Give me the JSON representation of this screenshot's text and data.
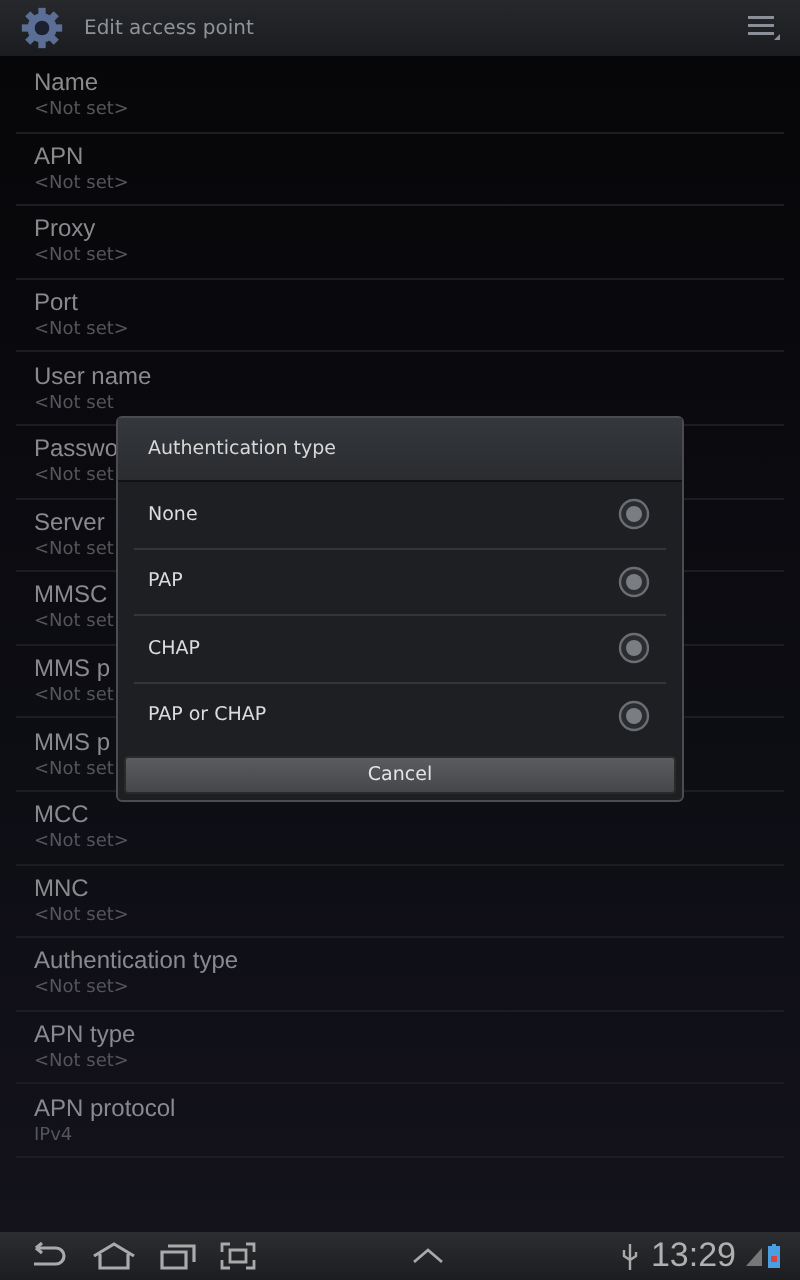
{
  "action_bar": {
    "title": "Edit access point"
  },
  "settings": [
    {
      "label": "Name",
      "value": "<Not set>"
    },
    {
      "label": "APN",
      "value": "<Not set>"
    },
    {
      "label": "Proxy",
      "value": "<Not set>"
    },
    {
      "label": "Port",
      "value": "<Not set>"
    },
    {
      "label": "User name",
      "value": "<Not set"
    },
    {
      "label": "Passwo",
      "value": "<Not set"
    },
    {
      "label": "Server",
      "value": "<Not set"
    },
    {
      "label": "MMSC",
      "value": "<Not set"
    },
    {
      "label": "MMS p",
      "value": "<Not set"
    },
    {
      "label": "MMS p",
      "value": "<Not set"
    },
    {
      "label": "MCC",
      "value": "<Not set>"
    },
    {
      "label": "MNC",
      "value": "<Not set>"
    },
    {
      "label": "Authentication type",
      "value": "<Not set>"
    },
    {
      "label": "APN type",
      "value": "<Not set>"
    },
    {
      "label": "APN protocol",
      "value": "IPv4"
    }
  ],
  "dialog": {
    "title": "Authentication type",
    "options": [
      {
        "label": "None",
        "selected": false
      },
      {
        "label": "PAP",
        "selected": false
      },
      {
        "label": "CHAP",
        "selected": false
      },
      {
        "label": "PAP or CHAP",
        "selected": false
      }
    ],
    "button": "Cancel"
  },
  "status_bar": {
    "time": "13:29"
  }
}
